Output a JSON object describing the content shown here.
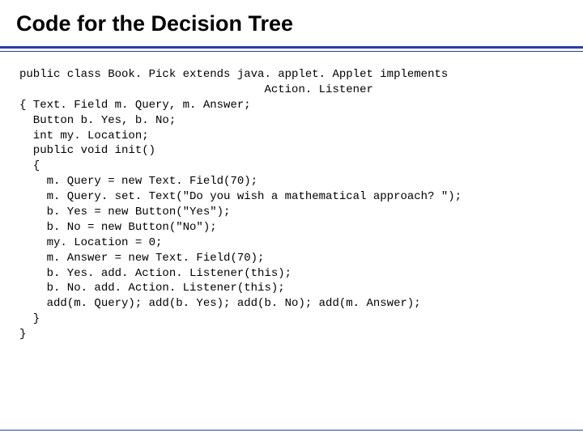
{
  "slide": {
    "title": "Code for the Decision Tree",
    "code_lines": [
      "public class Book. Pick extends java. applet. Applet implements",
      "                                    Action. Listener",
      "{ Text. Field m. Query, m. Answer;",
      "  Button b. Yes, b. No;",
      "  int my. Location;",
      "  public void init()",
      "  {",
      "    m. Query = new Text. Field(70);",
      "    m. Query. set. Text(\"Do you wish a mathematical approach? \");",
      "    b. Yes = new Button(\"Yes\");",
      "    b. No = new Button(\"No\");",
      "    my. Location = 0;",
      "    m. Answer = new Text. Field(70);",
      "    b. Yes. add. Action. Listener(this);",
      "    b. No. add. Action. Listener(this);",
      "    add(m. Query); add(b. Yes); add(b. No); add(m. Answer);",
      "  }",
      "}"
    ]
  }
}
